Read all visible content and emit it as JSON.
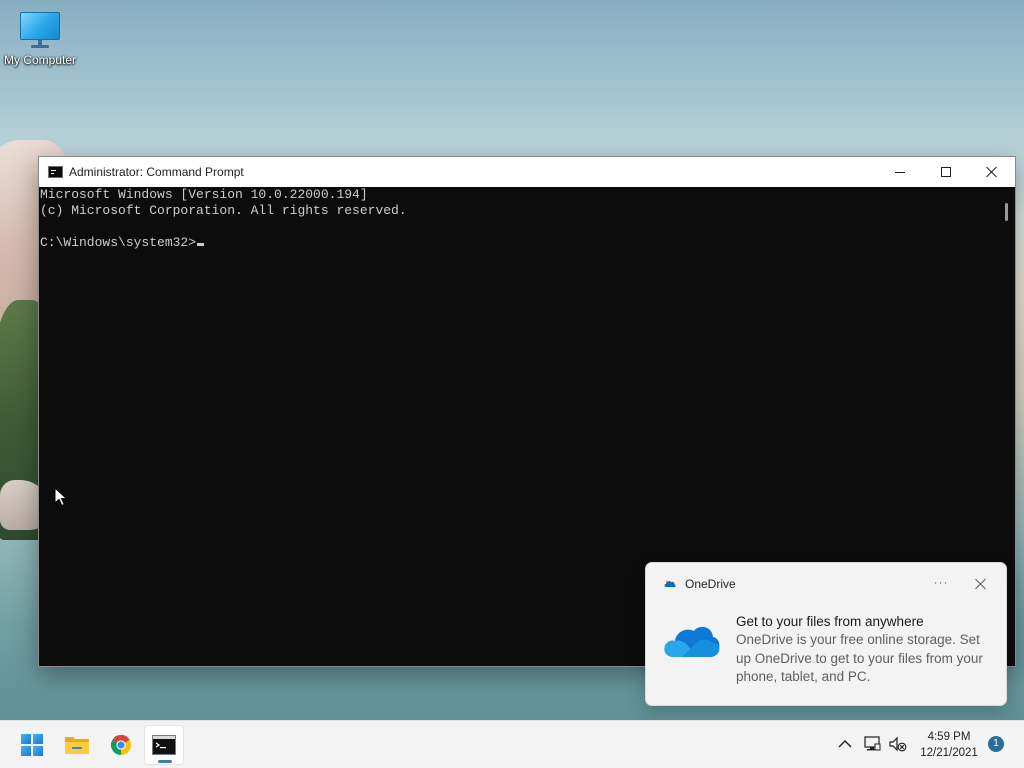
{
  "desktop": {
    "icons": [
      {
        "label": "My Computer",
        "icon": "monitor-icon"
      }
    ]
  },
  "cmd_window": {
    "title": "Administrator: Command Prompt",
    "icon": "console-icon",
    "controls": {
      "minimize": "minimize-icon",
      "maximize": "maximize-icon",
      "close": "close-icon"
    },
    "console_lines": [
      "Microsoft Windows [Version 10.0.22000.194]",
      "(c) Microsoft Corporation. All rights reserved.",
      "",
      "C:\\Windows\\system32>"
    ],
    "colors": {
      "background": "#0c0c0c",
      "text": "#cccccc"
    }
  },
  "toast": {
    "app_name": "OneDrive",
    "more_label": "···",
    "title": "Get to your files from anywhere",
    "message": "OneDrive is your free online storage. Set up OneDrive to get to your files from your phone, tablet, and PC.",
    "icon": "onedrive-cloud-icon"
  },
  "taskbar": {
    "apps": [
      {
        "name": "Start",
        "icon": "windows-start-icon",
        "active": false
      },
      {
        "name": "File Explorer",
        "icon": "folder-icon",
        "active": false
      },
      {
        "name": "Google Chrome",
        "icon": "chrome-icon",
        "active": false
      },
      {
        "name": "Command Prompt",
        "icon": "console-icon",
        "active": true
      }
    ],
    "tray": {
      "time": "4:59 PM",
      "date": "12/21/2021",
      "notification_count": "1"
    }
  }
}
